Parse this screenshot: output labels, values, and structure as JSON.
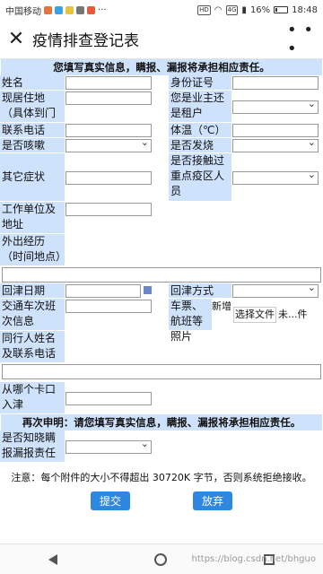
{
  "status": {
    "carrier": "中国移动",
    "net_badges": [
      "HD",
      "4G"
    ],
    "battery": "16%",
    "time": "18:48"
  },
  "titlebar": {
    "title": "疫情排查登记表",
    "close_icon": "close-icon",
    "more_icon": "more-icon"
  },
  "form": {
    "notice_top": "您填写真实信息，瞒报、漏报将承担相应责任。",
    "name_label": "姓名",
    "id_label": "身份证号",
    "address_label": "现居住地（具体到门牌号）",
    "owner_label": "您是业主还是租户",
    "phone_label": "联系电话",
    "temp_label": "体温（℃）",
    "cough_label": "是否咳嗽",
    "fever_label": "是否发烧",
    "other_label": "其它症状",
    "contact_label": "是否接触过重点疫区人员",
    "work_label": "工作单位及地址",
    "travel_label": "外出经历（时间地点）",
    "return_date_label": "回津日期",
    "return_way_label": "回津方式",
    "transport_label": "交通车次班次信息",
    "ticket_label": "车票、航班等照片",
    "ticket_new": "新增",
    "file_button": "选择文件",
    "file_status": "未...件",
    "companion_label": "同行人姓名及联系电话",
    "checkpoint_label": "从哪个卡口入津",
    "notice_again": "再次申明：请您填写真实信息，瞒报、漏报将承担相应责任。",
    "concealment_label": "是否知晓瞒报漏报责任",
    "attachment_note": "注意：每个附件的大小不得超出 30720K 字节，否则系统拒绝接收。",
    "submit_label": "提交",
    "abandon_label": "放弃"
  },
  "watermark": "https://blog.csdn.net/bhguo",
  "colors": {
    "label_bg": "#cfe2fb",
    "button_bg": "#2f88e0"
  }
}
